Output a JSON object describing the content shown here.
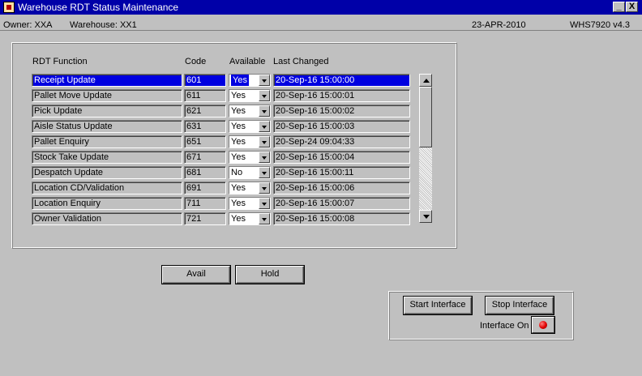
{
  "window": {
    "title": "Warehouse RDT Status Maintenance",
    "minimize_glyph": "_",
    "close_glyph": "X"
  },
  "status": {
    "owner": "Owner:  XXA",
    "warehouse": "Warehouse:  XX1",
    "date": "23-APR-2010",
    "screen": "WHS7920  v4.3"
  },
  "columns": {
    "function": "RDT Function",
    "code": "Code",
    "available": "Available",
    "changed": "Last Changed"
  },
  "rows": [
    {
      "function": "Receipt Update",
      "code": "601",
      "available": "Yes",
      "changed": "20-Sep-16 15:00:00"
    },
    {
      "function": "Pallet Move Update",
      "code": "611",
      "available": "Yes",
      "changed": "20-Sep-16 15:00:01"
    },
    {
      "function": "Pick Update",
      "code": "621",
      "available": "Yes",
      "changed": "20-Sep-16 15:00:02"
    },
    {
      "function": "Aisle Status Update",
      "code": "631",
      "available": "Yes",
      "changed": "20-Sep-16 15:00:03"
    },
    {
      "function": "Pallet Enquiry",
      "code": "651",
      "available": "Yes",
      "changed": "20-Sep-24 09:04:33"
    },
    {
      "function": "Stock Take Update",
      "code": "671",
      "available": "Yes",
      "changed": "20-Sep-16 15:00:04"
    },
    {
      "function": "Despatch Update",
      "code": "681",
      "available": "No",
      "changed": "20-Sep-16 15:00:11"
    },
    {
      "function": "Location CD/Validation",
      "code": "691",
      "available": "Yes",
      "changed": "20-Sep-16 15:00:06"
    },
    {
      "function": "Location Enquiry",
      "code": "711",
      "available": "Yes",
      "changed": "20-Sep-16 15:00:07"
    },
    {
      "function": "Owner Validation",
      "code": "721",
      "available": "Yes",
      "changed": "20-Sep-16 15:00:08"
    }
  ],
  "selected_row": 1,
  "buttons": {
    "avail": "Avail",
    "hold": "Hold",
    "start": "Start Interface",
    "stop": "Stop Interface"
  },
  "interface": {
    "label": "Interface On",
    "indicator": "red-led-icon",
    "status_color": "#e00000"
  },
  "colors": {
    "title_bar": "#0000a8",
    "selection": "#0000e0",
    "background": "#c0c0c0"
  }
}
